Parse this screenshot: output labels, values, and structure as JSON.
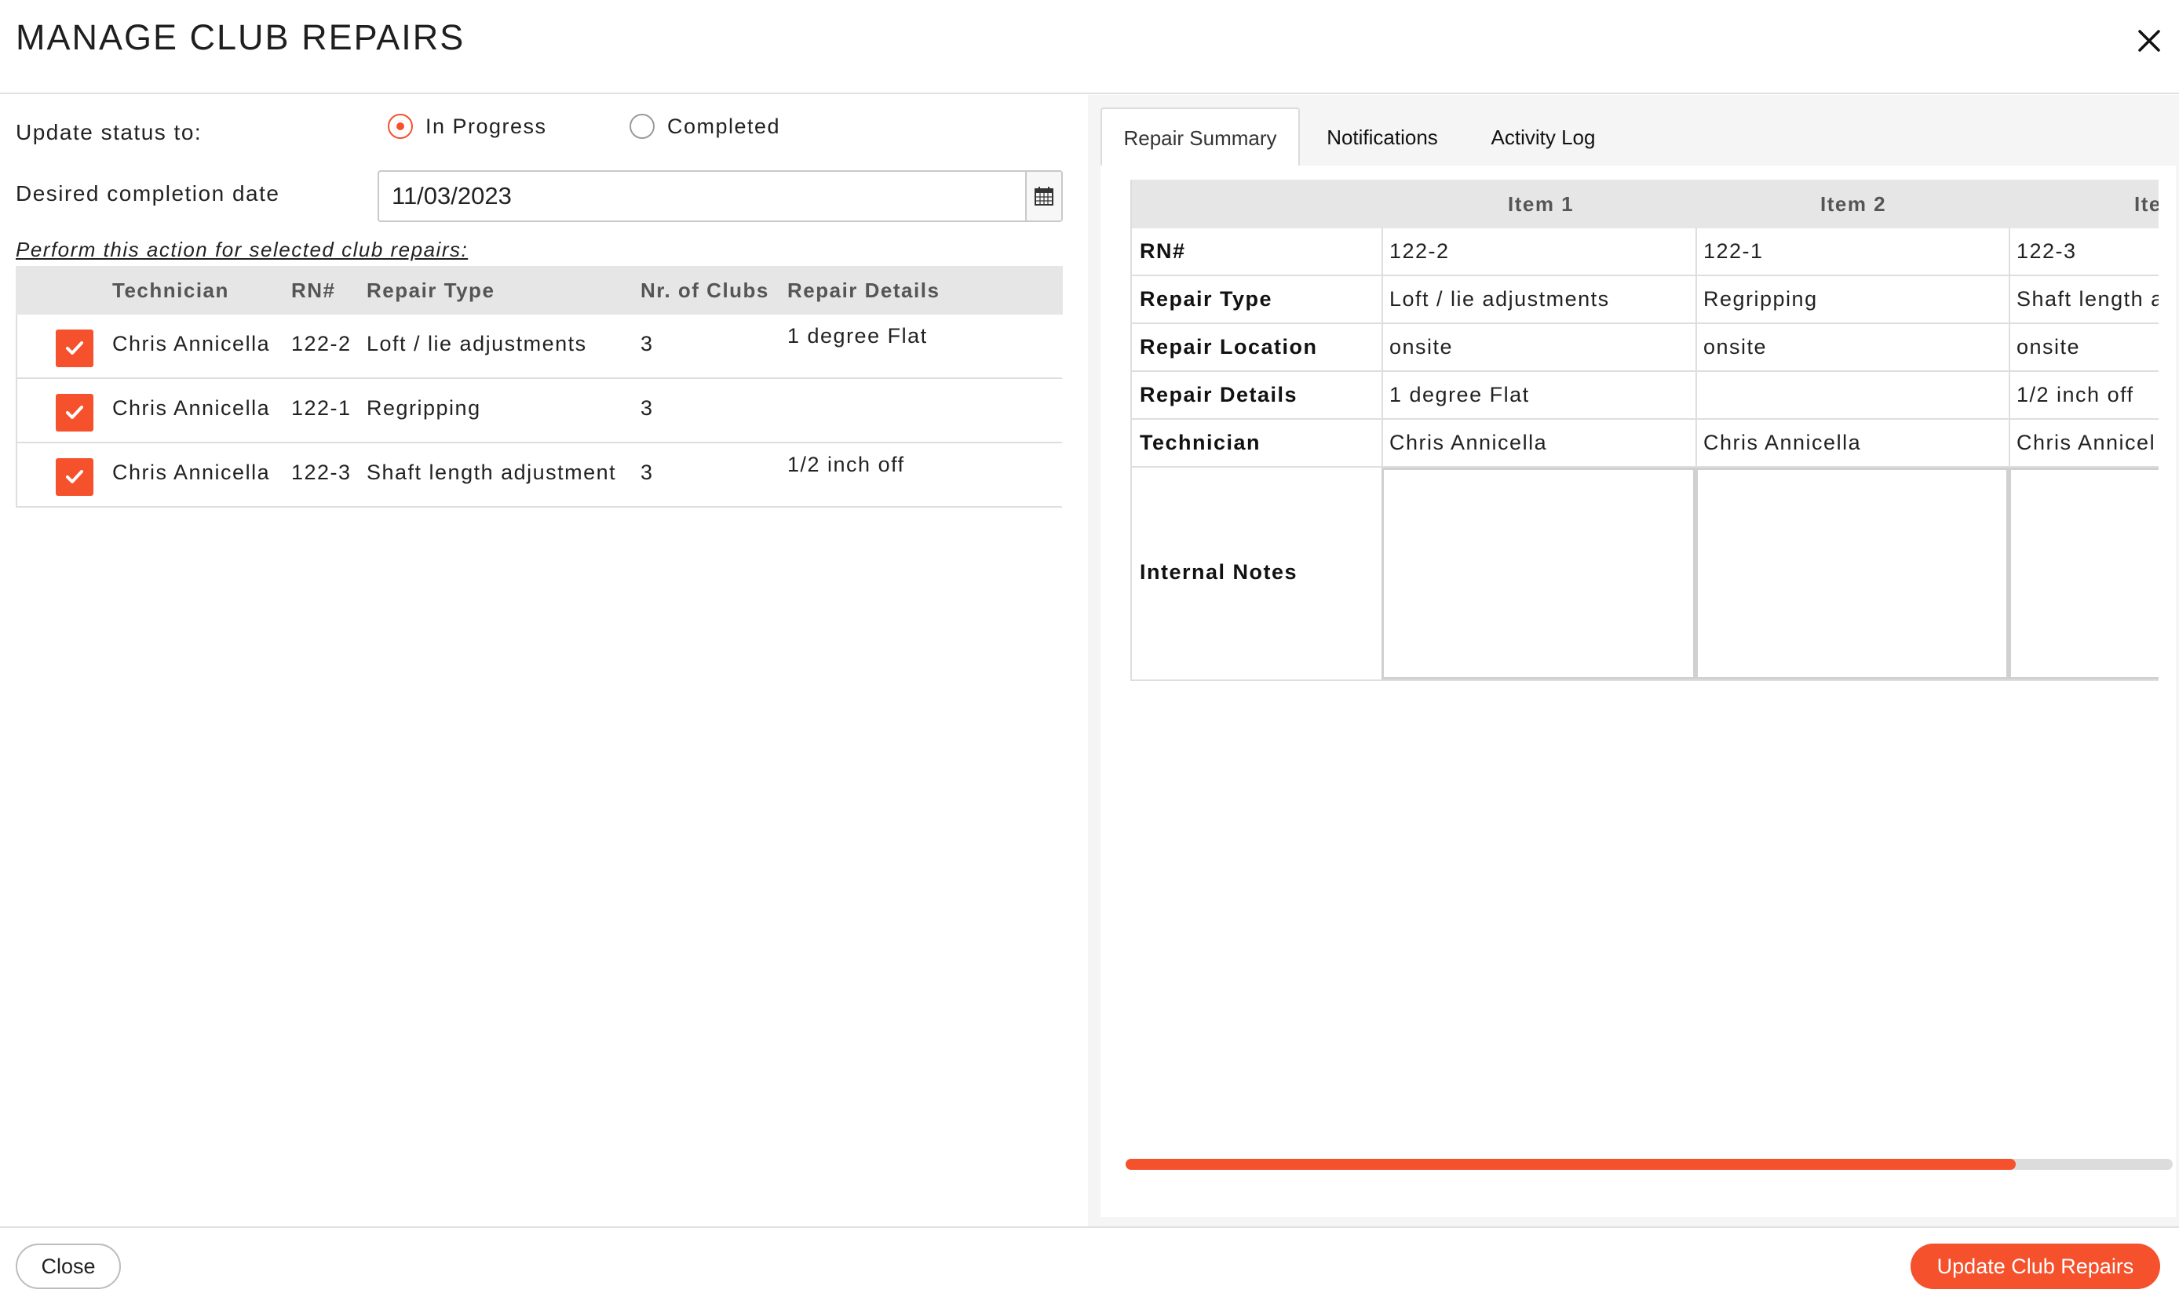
{
  "header": {
    "title": "MANAGE CLUB REPAIRS"
  },
  "status": {
    "label": "Update status to:",
    "options": [
      {
        "label": "In Progress",
        "selected": true
      },
      {
        "label": "Completed",
        "selected": false
      }
    ]
  },
  "completion": {
    "label": "Desired completion date",
    "value": "11/03/2023"
  },
  "selection": {
    "instruction": "Perform this action for selected club repairs:",
    "columns": [
      "Technician",
      "RN#",
      "Repair Type",
      "Nr. of Clubs",
      "Repair Details"
    ],
    "rows": [
      {
        "checked": true,
        "technician": "Chris Annicella",
        "rn": "122-2",
        "repair_type": "Loft / lie adjustments",
        "clubs": "3",
        "details": "1 degree Flat"
      },
      {
        "checked": true,
        "technician": "Chris Annicella",
        "rn": "122-1",
        "repair_type": "Regripping",
        "clubs": "3",
        "details": ""
      },
      {
        "checked": true,
        "technician": "Chris Annicella",
        "rn": "122-3",
        "repair_type": "Shaft length adjustment",
        "clubs": "3",
        "details": "1/2 inch off"
      }
    ]
  },
  "tabs": [
    {
      "label": "Repair Summary",
      "active": true
    },
    {
      "label": "Notifications",
      "active": false
    },
    {
      "label": "Activity Log",
      "active": false
    }
  ],
  "summary": {
    "items": [
      "Item 1",
      "Item 2",
      "Ite"
    ],
    "rows": [
      {
        "label": "RN#",
        "values": [
          "122-2",
          "122-1",
          "122-3"
        ]
      },
      {
        "label": "Repair Type",
        "values": [
          "Loft / lie adjustments",
          "Regripping",
          "Shaft length a"
        ]
      },
      {
        "label": "Repair Location",
        "values": [
          "onsite",
          "onsite",
          "onsite"
        ]
      },
      {
        "label": "Repair Details",
        "values": [
          "1 degree Flat",
          "",
          "1/2 inch off"
        ]
      },
      {
        "label": "Technician",
        "values": [
          "Chris Annicella",
          "Chris Annicella",
          "Chris Annicel"
        ]
      }
    ],
    "notes_label": "Internal Notes",
    "scroll_fraction": 0.85
  },
  "footer": {
    "close_label": "Close",
    "update_label": "Update Club Repairs"
  },
  "colors": {
    "accent": "#f4512c",
    "header_bg": "#e6e6e6",
    "border": "#dedede"
  }
}
